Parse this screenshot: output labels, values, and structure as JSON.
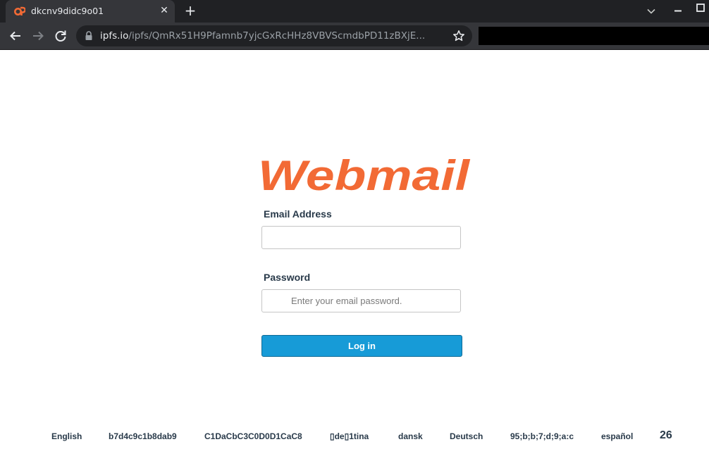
{
  "browser": {
    "tab_title": "dkcnv9didc9o01",
    "tab_favicon": "cpanel-icon",
    "new_tab_label": "+",
    "close_tab_label": "✕",
    "url_host": "ipfs.io",
    "url_path": "/ipfs/QmRx51H9Pfamnb7yjcGxRcHHz8VBVScmdbPD11zBXjE...",
    "icons": [
      "back-arrow-icon",
      "forward-arrow-icon",
      "reload-icon",
      "lock-icon",
      "bookmark-star-icon",
      "tab-search-chevron-icon",
      "minimize-icon",
      "maximize-icon"
    ]
  },
  "brand": {
    "logo_text": "Webmail",
    "color": "#f26a35"
  },
  "form": {
    "email_label": "Email Address",
    "email_value": "",
    "email_placeholder": "",
    "password_label": "Password",
    "password_value": "",
    "password_placeholder": "Enter your email password.",
    "login_label": "Log in",
    "button_color": "#179bd7"
  },
  "footer": {
    "languages": [
      "English",
      "b7d4c9c1b8dab9",
      "C1DaCbC3C0D0D1CaC8",
      "▯de▯1tina",
      "dansk",
      "Deutsch",
      "95;b;b;7;d;9;a:c",
      "español"
    ],
    "more_label": "26"
  }
}
